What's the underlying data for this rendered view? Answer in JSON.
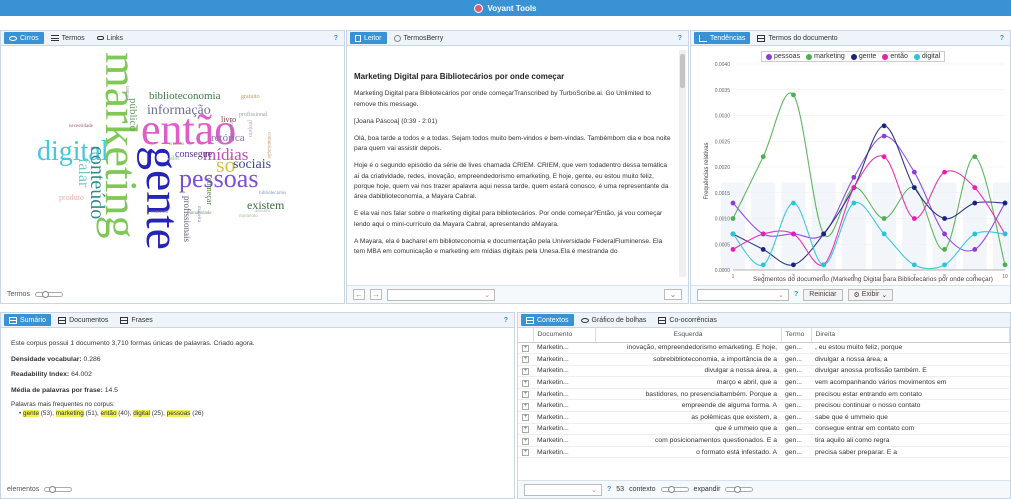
{
  "app": {
    "title": "Voyant Tools"
  },
  "cirrus": {
    "tabs": [
      {
        "label": "Cirros"
      },
      {
        "label": "Termos"
      },
      {
        "label": "Links"
      }
    ],
    "help": "?",
    "footer_label": "Termos",
    "words": [
      {
        "text": "marketing",
        "color": "#7fc856"
      },
      {
        "text": "então",
        "color": "#e05cc8"
      },
      {
        "text": "gente",
        "color": "#2424b8"
      },
      {
        "text": "pessoas",
        "color": "#7b4fd6"
      },
      {
        "text": "digital",
        "color": "#44c8e0"
      },
      {
        "text": "conteúdo",
        "color": "#2e8c8c"
      },
      {
        "text": "informação",
        "color": "#6f6f9e"
      },
      {
        "text": "biblioteconomia",
        "color": "#3a7b45"
      },
      {
        "text": "só",
        "color": "#d6c144"
      },
      {
        "text": "mídias",
        "color": "#c04dbd"
      },
      {
        "text": "sociais",
        "color": "#3a4a8c"
      },
      {
        "text": "existem",
        "color": "#3c6b3c"
      },
      {
        "text": "falar",
        "color": "#74c8c8"
      },
      {
        "text": "consegue",
        "color": "#5a3a8c"
      },
      {
        "text": "retórica",
        "color": "#8a6bb0"
      },
      {
        "text": "público",
        "color": "#6a9a6a"
      },
      {
        "text": "profissionais",
        "color": "#5a5a7a"
      },
      {
        "text": "começar",
        "color": "#4a7a4a"
      },
      {
        "text": "livro",
        "color": "#8c3a3a"
      },
      {
        "text": "produto",
        "color": "#e8b0b0"
      },
      {
        "text": "gratuito",
        "color": "#c8a04a"
      },
      {
        "text": "profissional",
        "color": "#9aa0a0"
      },
      {
        "text": "projeto",
        "color": "#c0a0c0"
      },
      {
        "text": "valor",
        "color": "#8cbf8c"
      },
      {
        "text": "entrevista",
        "color": "#7a7a9a"
      },
      {
        "text": "necessidade",
        "color": "#a06060"
      },
      {
        "text": "bibliotecários",
        "color": "#7a9ac0"
      },
      {
        "text": "tantas",
        "color": "#9a7aa0"
      },
      {
        "text": "assunto",
        "color": "#b0b0d0"
      },
      {
        "text": "humanidade",
        "color": "#7a9a7a"
      },
      {
        "text": "comunicação",
        "color": "#c09050"
      },
      {
        "text": "criando",
        "color": "#b08080"
      },
      {
        "text": "momento",
        "color": "#a0c0a0"
      },
      {
        "text": "contexto",
        "color": "#a070a0"
      },
      {
        "text": "maneira",
        "color": "#8080a0"
      }
    ]
  },
  "reader": {
    "tabs": [
      {
        "label": "Leitor"
      },
      {
        "label": "TermosBerry"
      }
    ],
    "help": "?",
    "title": "Marketing Digital para Bibliotecários por onde começar",
    "paragraphs": [
      "Marketing Digital para Bibliotecários por onde começarTranscribed by TurboScribe.ai. Go Unlimited to remove this message.",
      "[Joana Páscoa] (0:39 - 2:01)",
      "Olá, boa tarde a todos e a todas. Sejam todos muito bem-vindos e bem-vindas. Tambémbom dia e boa noite para quem vai assistir depois.",
      "Hoje é o segundo episódio da série de lives chamada CRIEM. CRIEM, que vem todadentro dessa temática aí da criatividade, redes, inovação, empreendedorismo emarketing. E hoje, gente, eu estou muito feliz, porque hoje, quem vai nos trazer apalavra aqui nessa tarde, quem estará conosco, é uma representante da área dabiblioteconomia, a Mayara Cabral.",
      "E ela vai nos falar sobre o marketing digital para bibliotecários. Por onde começar?Então, já vou começar lendo aqui o mini-currículo da Mayara Cabral, apresentando aMayara.",
      "A Mayara, ela é bacharel em biblioteconomia e documentação pela Universidade FederalFluminense. Ela tem MBA em comunicação e marketing em mídias digitais pela Unesa.Ela é mestranda do"
    ]
  },
  "trends": {
    "tabs": [
      {
        "label": "Tendências"
      },
      {
        "label": "Termos do documento"
      }
    ],
    "help": "?",
    "ylabel": "Frequências relativas",
    "xlabel": "Segmentos do documento (Marketing Digital para Bibliotecários por onde começar)",
    "reset_label": "Reiniciar",
    "display_label": "Exibir",
    "help_small": "?"
  },
  "chart_data": {
    "type": "line",
    "x": [
      1,
      2,
      3,
      4,
      5,
      6,
      7,
      8,
      9,
      10
    ],
    "ylim": [
      0,
      0.004
    ],
    "yticks": [
      "0.0000",
      "0.0005",
      "0.0010",
      "0.0015",
      "0.0020",
      "0.0025",
      "0.0030",
      "0.0035",
      "0.0040"
    ],
    "series": [
      {
        "name": "pessoas",
        "color": "#8b3cd9",
        "values": [
          0.0013,
          0.0007,
          0.0007,
          0.0007,
          0.0018,
          0.0026,
          0.0019,
          0.0007,
          0.0004,
          0.0013
        ]
      },
      {
        "name": "marketing",
        "color": "#4caf50",
        "values": [
          0.001,
          0.0022,
          0.0034,
          0.0007,
          0.0016,
          0.001,
          0.0016,
          0.0004,
          0.0022,
          0.0001
        ]
      },
      {
        "name": "gente",
        "color": "#1a237e",
        "values": [
          0.0007,
          0.0004,
          0.0001,
          0.0007,
          0.0016,
          0.0028,
          0.0016,
          0.001,
          0.0013,
          0.0013
        ]
      },
      {
        "name": "então",
        "color": "#e91eaf",
        "values": [
          0.0004,
          0.0007,
          0.0007,
          0.0001,
          0.0016,
          0.0022,
          0.001,
          0.0019,
          0.0016,
          0.0007
        ]
      },
      {
        "name": "digital",
        "color": "#26c6da",
        "values": [
          0.0007,
          0.0001,
          0.0013,
          0.0001,
          0.0013,
          0.0007,
          0.0001,
          0.0001,
          0.0007,
          0.0007
        ]
      }
    ]
  },
  "summary": {
    "tabs": [
      {
        "label": "Sumário"
      },
      {
        "label": "Documentos"
      },
      {
        "label": "Frases"
      }
    ],
    "help": "?",
    "intro": "Este corpus possui 1 documento 3,710 formas únicas de palavras. Criado agora.",
    "density_label": "Densidade vocabular:",
    "density_value": "0.286",
    "readability_label": "Readability Index:",
    "readability_value": "64.002",
    "avg_label": "Média de palavras por frase:",
    "avg_value": "14.5",
    "frequent_label": "Palavras mais frequentes no corpus:",
    "frequent": [
      {
        "word": "gente",
        "count": "(53)"
      },
      {
        "word": "marketing",
        "count": "(51)"
      },
      {
        "word": "então",
        "count": "(40)"
      },
      {
        "word": "digital",
        "count": "(25)"
      },
      {
        "word": "pessoas",
        "count": "(26)"
      }
    ],
    "footer_label": "elementos"
  },
  "contexts": {
    "tabs": [
      {
        "label": "Contextos"
      },
      {
        "label": "Gráfico de bolhas"
      },
      {
        "label": "Co-ocorrências"
      }
    ],
    "help": "?",
    "columns": [
      "Documento",
      "Esquerda",
      "Termo",
      "Direita"
    ],
    "rows": [
      {
        "doc": "Marketin...",
        "left": "inovação, empreendedorismo emarketing. E hoje,",
        "term": "gen...",
        "right": ", eu estou muito feliz, porque"
      },
      {
        "doc": "Marketin...",
        "left": "sobrebiblioteconomia, a importância de a",
        "term": "gen...",
        "right": "divulgar a nossa área, a"
      },
      {
        "doc": "Marketin...",
        "left": "divulgar a nossa área, a",
        "term": "gen...",
        "right": "divulgar anossa profissão também. E"
      },
      {
        "doc": "Marketin...",
        "left": "março e abril, que a",
        "term": "gen...",
        "right": "vem acompanhando vários movimentos em"
      },
      {
        "doc": "Marketin...",
        "left": "bastidores, no presencialtambém. Porque a",
        "term": "gen...",
        "right": "precisou estar entrando em contato"
      },
      {
        "doc": "Marketin...",
        "left": "empreende de alguma forma. A",
        "term": "gen...",
        "right": "precisou continuar o nosso contato"
      },
      {
        "doc": "Marketin...",
        "left": "as polêmicas que existem, a",
        "term": "gen...",
        "right": "sabe que é ummeio que"
      },
      {
        "doc": "Marketin...",
        "left": "que é ummeio que a",
        "term": "gen...",
        "right": "consegue entrar em contato com"
      },
      {
        "doc": "Marketin...",
        "left": "com posicionamentos questionados. E a",
        "term": "gen...",
        "right": "tira aquilo ali como regra"
      },
      {
        "doc": "Marketin...",
        "left": "o formato está infestado. A",
        "term": "gen...",
        "right": "precisa saber preparar. E a"
      }
    ],
    "footer_count": "53",
    "context_label": "contexto",
    "expand_label": "expandir",
    "help_small": "?"
  }
}
